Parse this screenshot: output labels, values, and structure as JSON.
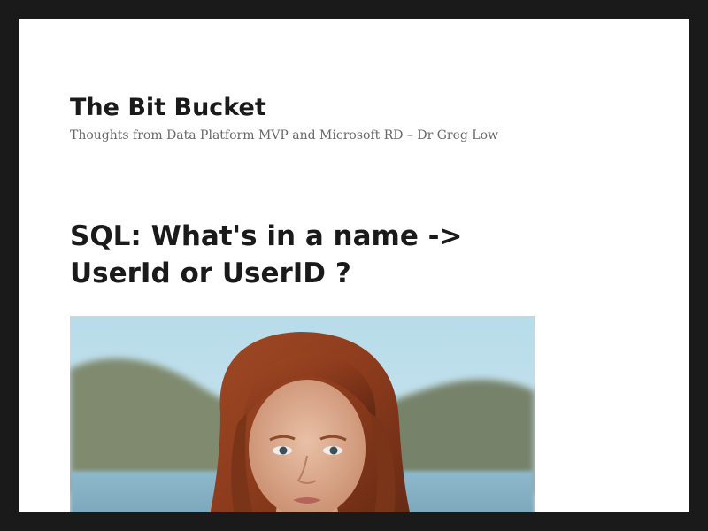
{
  "site": {
    "title": "The Bit Bucket",
    "description": "Thoughts from Data Platform MVP and Microsoft RD – Dr Greg Low"
  },
  "post": {
    "title_line1": "SQL: What's in a name ->",
    "title_line2": "UserId or UserID ?",
    "thumbnail": {
      "subject": "portrait photo of a red-haired woman by a lake"
    }
  },
  "colors": {
    "frame": "#1a1a1a",
    "page_background": "#ffffff",
    "text_primary": "#1a1a1a",
    "text_secondary": "#686868"
  }
}
